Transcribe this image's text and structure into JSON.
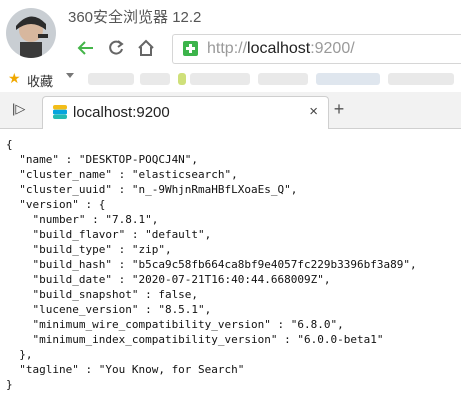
{
  "window": {
    "title": "360安全浏览器 12.2"
  },
  "toolbar": {
    "back_icon": "back-arrow-icon",
    "reload_icon": "reload-icon",
    "home_icon": "home-icon"
  },
  "address_bar": {
    "scheme": "http://",
    "host": "localhost",
    "rest": ":9200/",
    "security_icon": "shield-plus-icon"
  },
  "bookmarks": {
    "label": "收藏",
    "icon": "star-icon"
  },
  "tabs": [
    {
      "title": "localhost:9200",
      "icon": "elasticsearch-icon"
    }
  ],
  "json_response": {
    "open_brace": "{",
    "close_brace": "}",
    "lines": [
      "  \"name\" : \"DESKTOP-POQCJ4N\",",
      "  \"cluster_name\" : \"elasticsearch\",",
      "  \"cluster_uuid\" : \"n_-9WhjnRmaHBfLXoaEs_Q\",",
      "  \"version\" : {",
      "    \"number\" : \"7.8.1\",",
      "    \"build_flavor\" : \"default\",",
      "    \"build_type\" : \"zip\",",
      "    \"build_hash\" : \"b5ca9c58fb664ca8bf9e4057fc229b3396bf3a89\",",
      "    \"build_date\" : \"2020-07-21T16:40:44.668009Z\",",
      "    \"build_snapshot\" : false,",
      "    \"lucene_version\" : \"8.5.1\",",
      "    \"minimum_wire_compatibility_version\" : \"6.8.0\",",
      "    \"minimum_index_compatibility_version\" : \"6.0.0-beta1\"",
      "  },",
      "  \"tagline\" : \"You Know, for Search\""
    ]
  },
  "colors": {
    "accent_green": "#44b549",
    "star": "#f0a800",
    "tab_bg": "#f2f2f2"
  }
}
